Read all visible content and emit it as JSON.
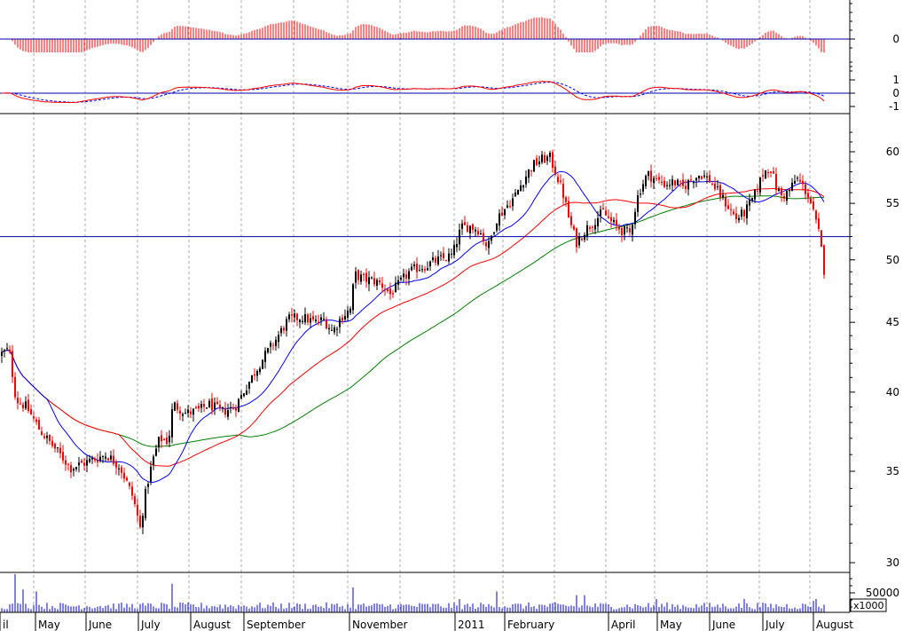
{
  "chart_data": {
    "type": "candlestick",
    "title": "",
    "volume_multiplier_label": "x1000",
    "months": [
      "il",
      "May",
      "June",
      "July",
      "August",
      "September",
      "November",
      "2011",
      "February",
      "April",
      "May",
      "June",
      "July",
      "August"
    ],
    "price_axis": {
      "scale": "log",
      "ylim": [
        29.5,
        63
      ],
      "ticks": [
        30,
        35,
        40,
        45,
        50,
        55,
        60
      ]
    },
    "reference_line_price": 52,
    "volume_axis": {
      "ticks": [
        50000
      ]
    },
    "macd_histogram_axis": {
      "ticks": [
        0
      ]
    },
    "macd_axis": {
      "ticks": [
        1,
        0,
        -1
      ]
    },
    "colors": {
      "up_candle": "#000000",
      "down_candle": "#ff0000",
      "ma_short": "#0000ff",
      "ma_mid": "#ff0000",
      "ma_long": "#008000",
      "histogram": "#ff0000",
      "volume": "#0000cc",
      "frame": "#000000",
      "grid": "#aaaaaa"
    },
    "close_anchors": [
      [
        0,
        42.6
      ],
      [
        10,
        43.0
      ],
      [
        18,
        39.5
      ],
      [
        30,
        39.0
      ],
      [
        45,
        37.5
      ],
      [
        60,
        36.5
      ],
      [
        80,
        35.2
      ],
      [
        100,
        35.6
      ],
      [
        120,
        36.0
      ],
      [
        135,
        35.3
      ],
      [
        150,
        33.5
      ],
      [
        158,
        31.8
      ],
      [
        165,
        34.0
      ],
      [
        172,
        35.6
      ],
      [
        180,
        37.0
      ],
      [
        190,
        36.8
      ],
      [
        195,
        39.2
      ],
      [
        210,
        38.6
      ],
      [
        225,
        38.8
      ],
      [
        235,
        39.2
      ],
      [
        250,
        38.7
      ],
      [
        265,
        39.0
      ],
      [
        280,
        40.6
      ],
      [
        295,
        42.2
      ],
      [
        310,
        43.6
      ],
      [
        325,
        45.2
      ],
      [
        340,
        45.4
      ],
      [
        355,
        45.0
      ],
      [
        365,
        45.2
      ],
      [
        375,
        44.3
      ],
      [
        385,
        45.4
      ],
      [
        395,
        46.0
      ],
      [
        400,
        48.8
      ],
      [
        410,
        48.4
      ],
      [
        420,
        48.3
      ],
      [
        430,
        48.0
      ],
      [
        440,
        47.2
      ],
      [
        450,
        48.0
      ],
      [
        460,
        48.9
      ],
      [
        470,
        49.3
      ],
      [
        480,
        49.5
      ],
      [
        490,
        49.9
      ],
      [
        500,
        50.1
      ],
      [
        510,
        50.4
      ],
      [
        520,
        52.8
      ],
      [
        530,
        52.9
      ],
      [
        540,
        52.6
      ],
      [
        550,
        51.0
      ],
      [
        560,
        53.6
      ],
      [
        570,
        54.6
      ],
      [
        580,
        55.6
      ],
      [
        590,
        57.2
      ],
      [
        600,
        58.6
      ],
      [
        610,
        59.2
      ],
      [
        620,
        59.4
      ],
      [
        628,
        57.6
      ],
      [
        635,
        55.8
      ],
      [
        642,
        53.4
      ],
      [
        650,
        51.5
      ],
      [
        660,
        52.6
      ],
      [
        670,
        53.4
      ],
      [
        680,
        54.2
      ],
      [
        690,
        53.2
      ],
      [
        700,
        52.6
      ],
      [
        710,
        52.3
      ],
      [
        720,
        56.0
      ],
      [
        730,
        57.8
      ],
      [
        740,
        57.2
      ],
      [
        750,
        56.8
      ],
      [
        760,
        57.0
      ],
      [
        770,
        56.5
      ],
      [
        780,
        57.3
      ],
      [
        790,
        57.8
      ],
      [
        800,
        57.2
      ],
      [
        810,
        56.0
      ],
      [
        820,
        54.8
      ],
      [
        830,
        53.6
      ],
      [
        840,
        54.2
      ],
      [
        850,
        55.6
      ],
      [
        860,
        57.8
      ],
      [
        868,
        58.6
      ],
      [
        875,
        56.5
      ],
      [
        882,
        55.6
      ],
      [
        890,
        56.2
      ],
      [
        898,
        57.4
      ],
      [
        905,
        56.6
      ],
      [
        912,
        55.6
      ],
      [
        918,
        53.8
      ],
      [
        924,
        52.0
      ],
      [
        930,
        48.6
      ]
    ],
    "volume_spikes": [
      [
        18,
        1.0
      ],
      [
        28,
        0.6
      ],
      [
        42,
        0.55
      ],
      [
        195,
        0.75
      ],
      [
        398,
        0.65
      ],
      [
        520,
        0.35
      ],
      [
        560,
        0.55
      ],
      [
        650,
        0.45
      ],
      [
        660,
        0.45
      ],
      [
        740,
        0.35
      ],
      [
        840,
        0.35
      ],
      [
        918,
        0.3
      ],
      [
        922,
        0.35
      ]
    ]
  }
}
